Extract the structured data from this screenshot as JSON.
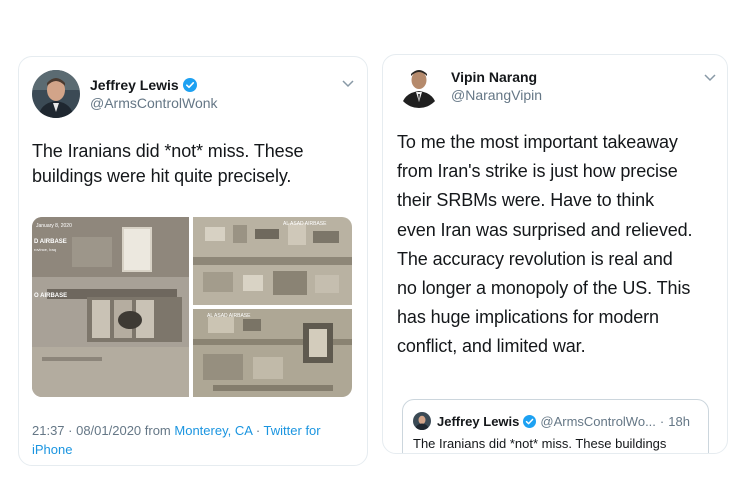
{
  "tweet1": {
    "author_name": "Jeffrey Lewis",
    "author_handle": "@ArmsControlWonk",
    "text_lines": [
      "The Iranians did *not* miss. These",
      "buildings were hit quite precisely."
    ],
    "image_labels": {
      "date": "January 8, 2020",
      "airbase_top": "D AIRBASE",
      "airbase_top_sub": "rovince, Iraq",
      "airbase_mid": "O AIRBASE",
      "right_top": "AL ASAD AIRBASE",
      "right_bottom": "AL ASAD AIRBASE"
    },
    "meta_time": "21:37 · 08/01/2020 from",
    "meta_location": "Monterey, CA",
    "meta_sep": "·",
    "meta_source": "Twitter for iPhone",
    "verified_icon": "verified-badge-icon",
    "colors": {
      "link": "#1b95e0",
      "verified": "#1da1f2"
    }
  },
  "tweet2": {
    "author_name": "Vipin Narang",
    "author_handle": "@NarangVipin",
    "text_lines": [
      "To me the most important takeaway",
      "from Iran's strike is just how precise",
      "their SRBMs were. Have to think",
      "even Iran was surprised and relieved.",
      "The accuracy revolution is real and",
      "no longer a monopoly of the US. This",
      "has huge implications for modern",
      "conflict, and limited war."
    ],
    "quote": {
      "author_name": "Jeffrey Lewis",
      "author_handle": "@ArmsControlWo...",
      "sep": "·",
      "time": "18h",
      "text": "The Iranians did *not* miss. These buildings"
    }
  }
}
